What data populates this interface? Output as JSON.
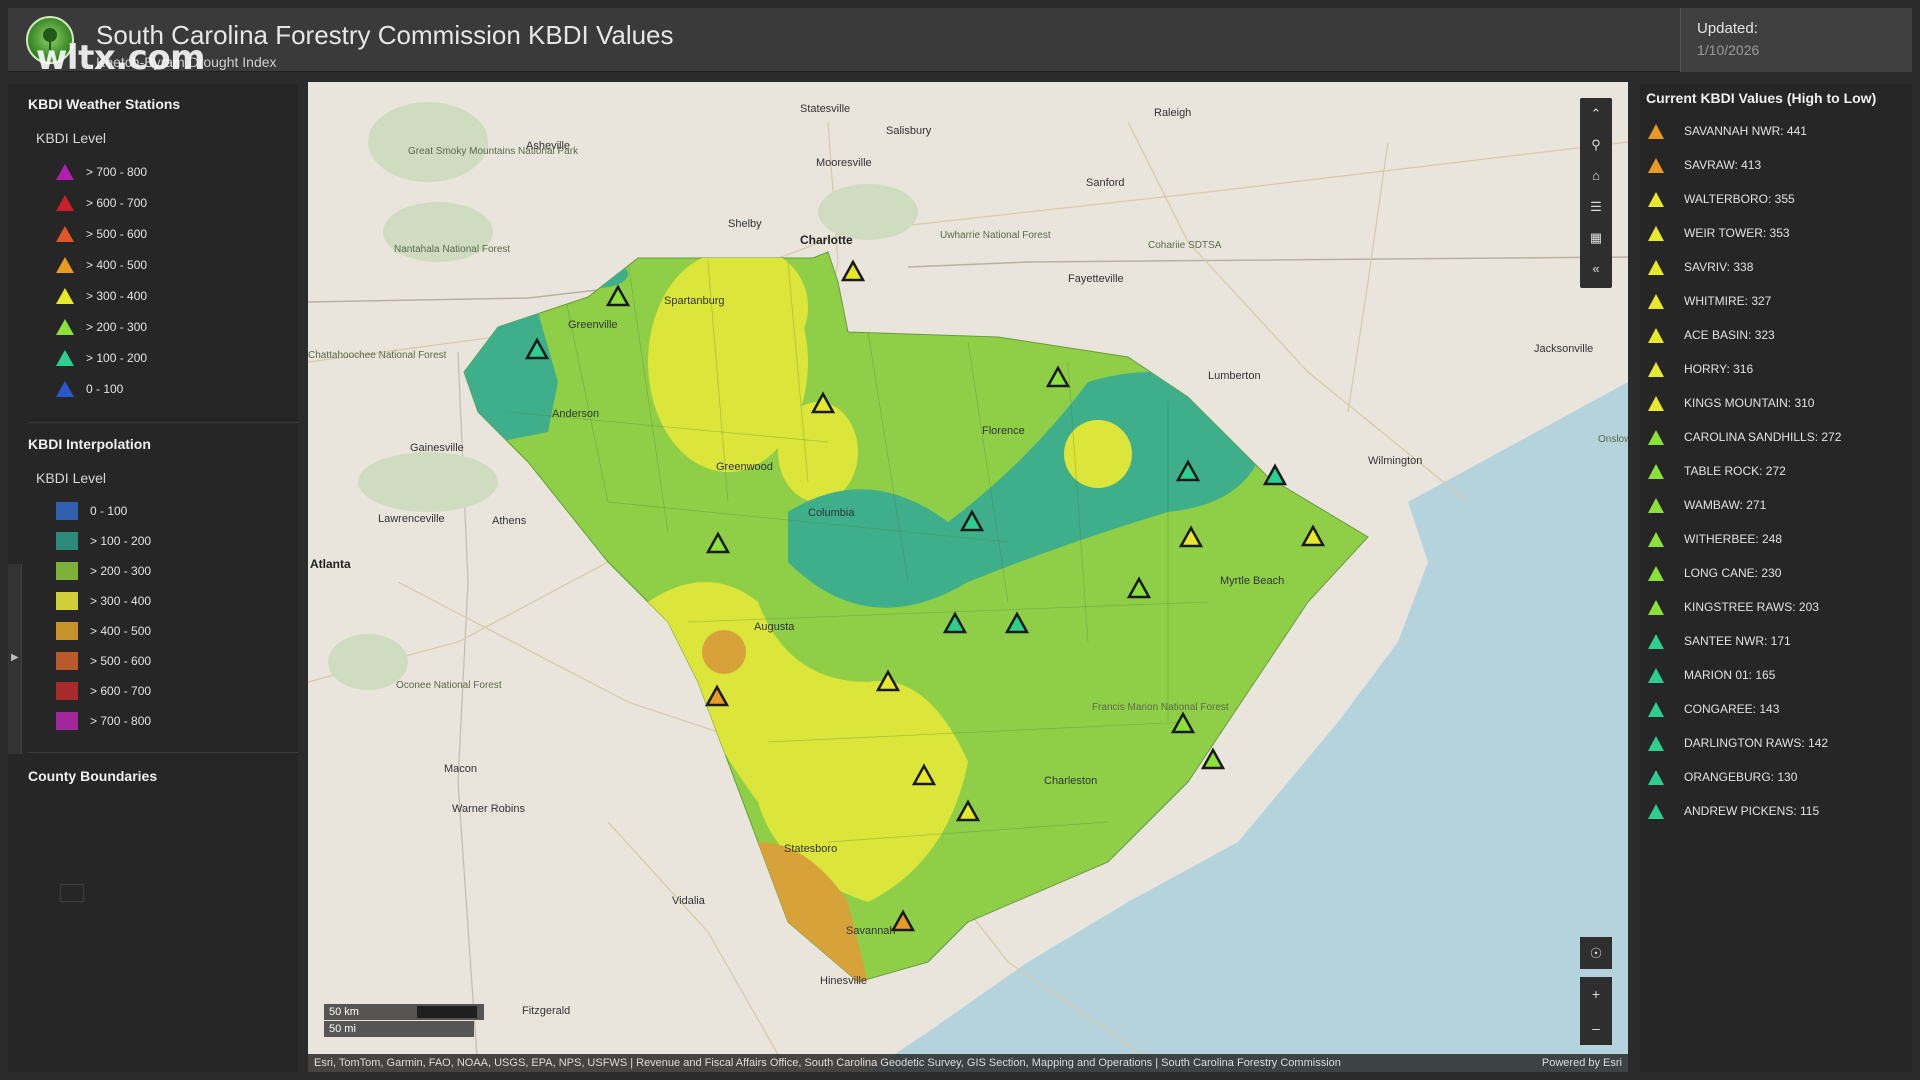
{
  "header": {
    "title": "South Carolina Forestry Commission KBDI Values",
    "subtitle": "Keetch-Byram Drought Index",
    "watermark": "wltx.com",
    "updated_label": "Updated:",
    "updated_date": "1/10/2026"
  },
  "weather_stations_legend": {
    "title": "KBDI Weather Stations",
    "subtitle": "KBDI Level",
    "items": [
      {
        "label": "> 700 - 800",
        "color": "#b01fb0"
      },
      {
        "label": "> 600 - 700",
        "color": "#c8202a"
      },
      {
        "label": "> 500 - 600",
        "color": "#e0562a"
      },
      {
        "label": "> 400 - 500",
        "color": "#e89a22"
      },
      {
        "label": "> 300 - 400",
        "color": "#e8e82a"
      },
      {
        "label": "> 200 - 300",
        "color": "#8be03a"
      },
      {
        "label": "> 100 - 200",
        "color": "#2ccf8f"
      },
      {
        "label": "0 - 100",
        "color": "#2a58c8"
      }
    ]
  },
  "interpolation_legend": {
    "title": "KBDI Interpolation",
    "subtitle": "KBDI Level",
    "items": [
      {
        "label": "0 - 100",
        "color": "#2f5fae"
      },
      {
        "label": "> 100 - 200",
        "color": "#2c8a78"
      },
      {
        "label": "> 200 - 300",
        "color": "#7fb03a"
      },
      {
        "label": "> 300 - 400",
        "color": "#cfcf3a"
      },
      {
        "label": "> 400 - 500",
        "color": "#c8922a"
      },
      {
        "label": "> 500 - 600",
        "color": "#b85a2a"
      },
      {
        "label": "> 600 - 700",
        "color": "#a82a2a"
      },
      {
        "label": "> 700 - 800",
        "color": "#a0289a"
      }
    ]
  },
  "county_legend": {
    "title": "County Boundaries"
  },
  "map": {
    "cities": [
      "Statesville",
      "Raleigh",
      "Asheville",
      "Salisbury",
      "Great Smoky Mountains National Park",
      "Mooresville",
      "Sanford",
      "Shelby",
      "Charlotte",
      "Uwharrie National Forest",
      "Nantahala National Forest",
      "Fayetteville",
      "Cohariie SDTSA",
      "Spartanburg",
      "Greenville",
      "Jacksonville",
      "Chattahoochee National Forest",
      "Lumberton",
      "Gainesville",
      "Anderson",
      "Florence",
      "Wilmington",
      "Onslow Bay",
      "Lawrenceville",
      "Athens",
      "Atlanta",
      "Greenwood",
      "Columbia",
      "Myrtle Beach",
      "Augusta",
      "Oconee National Forest",
      "Macon",
      "Charleston",
      "Warner Robins",
      "Statesboro",
      "Vidalia",
      "Savannah",
      "Hinesville",
      "Fitzgerald",
      "Francis Marion National Forest"
    ],
    "stations": [
      {
        "value_class": "300-400"
      },
      {
        "value_class": "200-300"
      },
      {
        "value_class": "100-200"
      },
      {
        "value_class": "300-400"
      },
      {
        "value_class": "200-300"
      },
      {
        "value_class": "100-200"
      },
      {
        "value_class": "100-200"
      },
      {
        "value_class": "300-400"
      },
      {
        "value_class": "300-400"
      },
      {
        "value_class": "200-300"
      },
      {
        "value_class": "100-200"
      },
      {
        "value_class": "200-300"
      },
      {
        "value_class": "100-200"
      },
      {
        "value_class": "100-200"
      },
      {
        "value_class": "300-400"
      },
      {
        "value_class": "400-500"
      },
      {
        "value_class": "200-300"
      },
      {
        "value_class": "200-300"
      },
      {
        "value_class": "300-400"
      },
      {
        "value_class": "300-400"
      },
      {
        "value_class": "400-500"
      }
    ],
    "scale_km": "50 km",
    "scale_mi": "50 mi",
    "attribution": "Esri, TomTom, Garmin, FAO, NOAA, USGS, EPA, NPS, USFWS | Revenue and Fiscal Affairs Office, South Carolina Geodetic Survey, GIS Section, Mapping and Operations | South Carolina Forestry Commission",
    "powered_by": "Powered by Esri",
    "toolbar": [
      "collapse-up",
      "search",
      "home",
      "layers",
      "basemap-gallery",
      "collapse-left"
    ]
  },
  "right_panel": {
    "title": "Current KBDI Values (High to Low)",
    "stations": [
      {
        "name": "SAVANNAH NWR",
        "value": "441",
        "color": "#e89a22"
      },
      {
        "name": "SAVRAW",
        "value": "413",
        "color": "#e89a22"
      },
      {
        "name": "WALTERBORO",
        "value": "355",
        "color": "#e8e82a"
      },
      {
        "name": "WEIR TOWER",
        "value": "353",
        "color": "#e8e82a"
      },
      {
        "name": "SAVRIV",
        "value": "338",
        "color": "#e8e82a"
      },
      {
        "name": "WHITMIRE",
        "value": "327",
        "color": "#e8e82a"
      },
      {
        "name": "ACE BASIN",
        "value": "323",
        "color": "#e8e82a"
      },
      {
        "name": "HORRY",
        "value": "316",
        "color": "#e8e82a"
      },
      {
        "name": "KINGS MOUNTAIN",
        "value": "310",
        "color": "#e8e82a"
      },
      {
        "name": "CAROLINA SANDHILLS",
        "value": "272",
        "color": "#8be03a"
      },
      {
        "name": "TABLE ROCK",
        "value": "272",
        "color": "#8be03a"
      },
      {
        "name": "WAMBAW",
        "value": "271",
        "color": "#8be03a"
      },
      {
        "name": "WITHERBEE",
        "value": "248",
        "color": "#8be03a"
      },
      {
        "name": "LONG CANE",
        "value": "230",
        "color": "#8be03a"
      },
      {
        "name": "KINGSTREE RAWS",
        "value": "203",
        "color": "#8be03a"
      },
      {
        "name": "SANTEE NWR",
        "value": "171",
        "color": "#2ccf8f"
      },
      {
        "name": "MARION 01",
        "value": "165",
        "color": "#2ccf8f"
      },
      {
        "name": "CONGAREE",
        "value": "143",
        "color": "#2ccf8f"
      },
      {
        "name": "DARLINGTON RAWS",
        "value": "142",
        "color": "#2ccf8f"
      },
      {
        "name": "ORANGEBURG",
        "value": "130",
        "color": "#2ccf8f"
      },
      {
        "name": "ANDREW PICKENS",
        "value": "115",
        "color": "#2ccf8f"
      }
    ]
  }
}
